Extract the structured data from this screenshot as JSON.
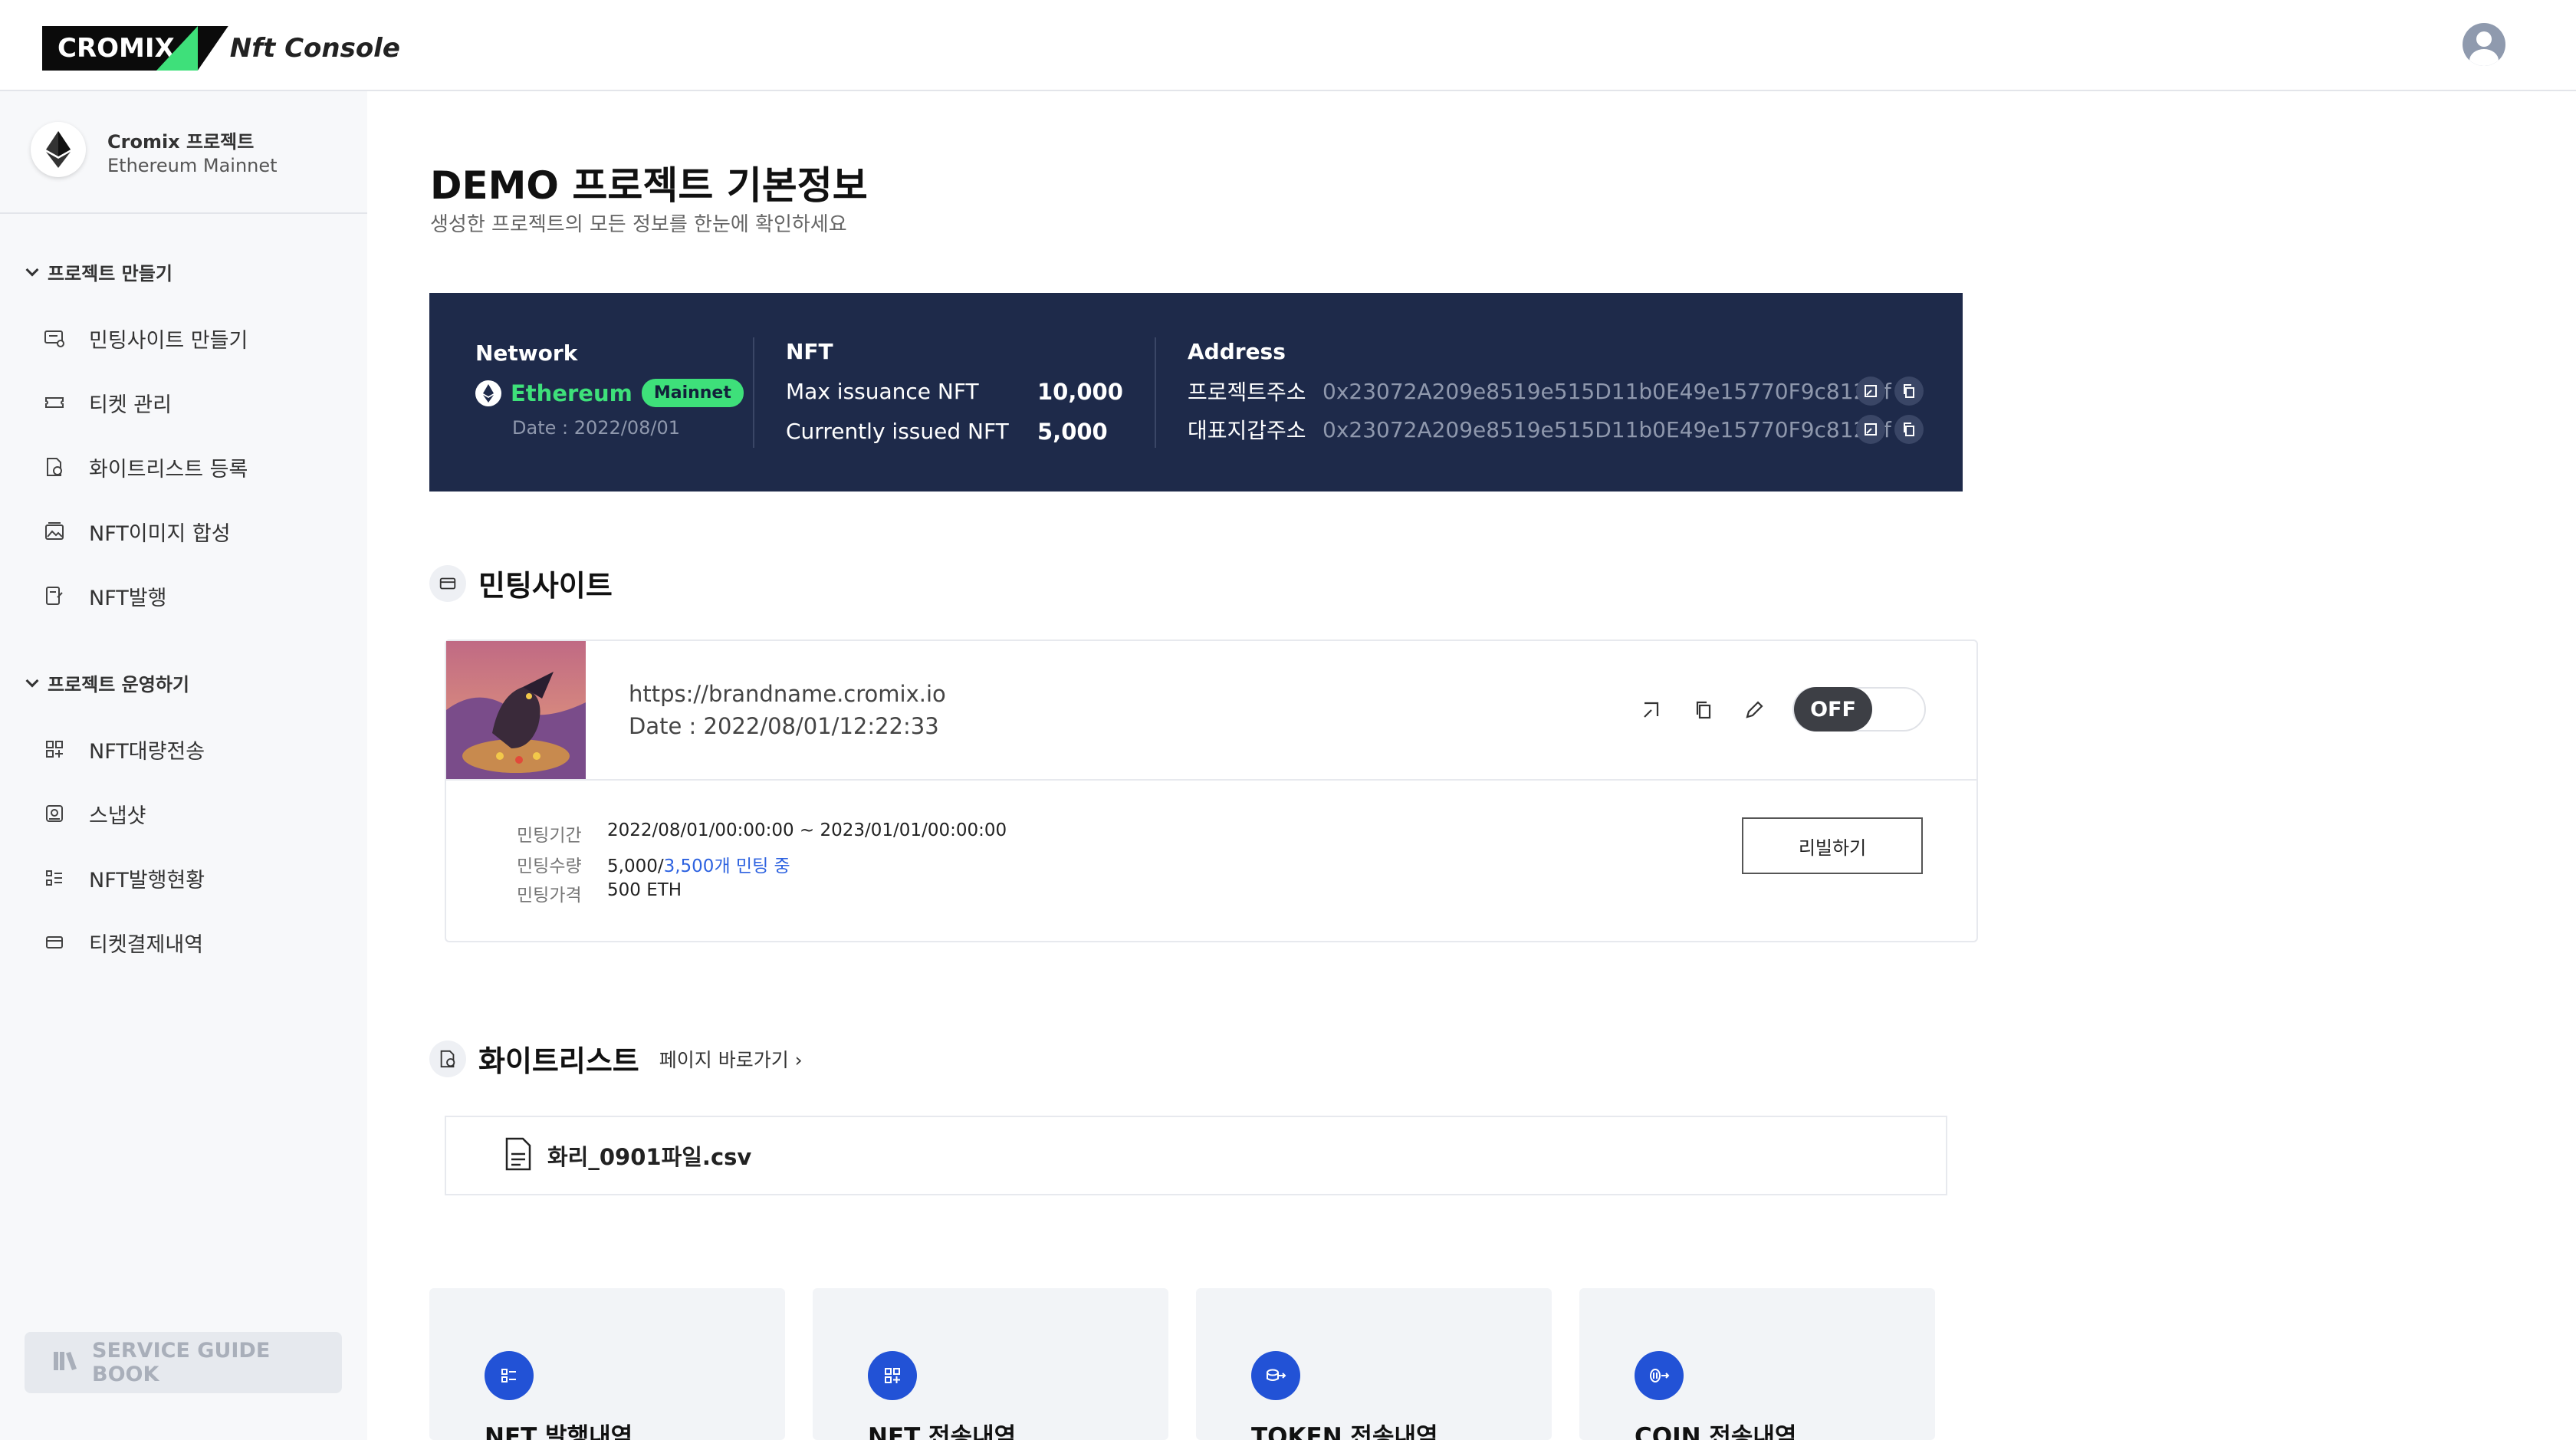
{
  "header": {
    "logo_text": "CROMIX",
    "logo_sub": "Nft Console",
    "user_icon": "user-circle-icon"
  },
  "sidebar": {
    "project_name": "Cromix 프로젝트",
    "project_network": "Ethereum Mainnet",
    "groups": [
      {
        "label": "프로젝트 만들기",
        "items": [
          {
            "label": "민팅사이트 만들기",
            "icon": "mint-site-icon"
          },
          {
            "label": "티켓 관리",
            "icon": "ticket-icon"
          },
          {
            "label": "화이트리스트 등록",
            "icon": "whitelist-icon"
          },
          {
            "label": "NFT이미지 합성",
            "icon": "image-compose-icon"
          },
          {
            "label": "NFT발행",
            "icon": "nft-issue-icon"
          }
        ]
      },
      {
        "label": "프로젝트 운영하기",
        "items": [
          {
            "label": "NFT대량전송",
            "icon": "bulk-transfer-icon"
          },
          {
            "label": "스냅샷",
            "icon": "snapshot-icon"
          },
          {
            "label": "NFT발행현황",
            "icon": "issue-status-icon"
          },
          {
            "label": "티켓결제내역",
            "icon": "payment-icon"
          }
        ]
      }
    ],
    "guide_label": "SERVICE GUIDE BOOK"
  },
  "main": {
    "title": "DEMO 프로젝트 기본정보",
    "subtitle": "생성한 프로젝트의 모든 정보를 한눈에 확인하세요",
    "info": {
      "network_label": "Network",
      "network_name": "Ethereum",
      "network_badge": "Mainnet",
      "date": "Date : 2022/08/01",
      "nft_label": "NFT",
      "max_label": "Max issuance NFT",
      "max_value": "10,000",
      "issued_label": "Currently issued NFT",
      "issued_value": "5,000",
      "address_label": "Address",
      "project_addr_label": "프로젝트주소",
      "project_addr": "0x23072A209e8519e515D11b0E49e15770F9c812Df",
      "wallet_addr_label": "대표지갑주소",
      "wallet_addr": "0x23072A209e8519e515D11b0E49e15770F9c812Df"
    },
    "minting": {
      "section_title": "민팅사이트",
      "url": "https://brandname.cromix.io",
      "date": "Date : 2022/08/01/12:22:33",
      "toggle": "OFF",
      "period_label": "민팅기간",
      "period_value": "2022/08/01/00:00:00 ~ 2023/01/01/00:00:00",
      "count_label": "민팅수량",
      "count_total": "5,000/",
      "count_progress": "3,500개 민팅 중",
      "price_label": "민팅가격",
      "price_value": "500 ETH",
      "rebuild_label": "리빌하기"
    },
    "whitelist": {
      "section_title": "화이트리스트",
      "link": "페이지 바로가기",
      "file_name": "화리_0901파일.csv"
    },
    "tiles": [
      {
        "label": "NFT 발행내역",
        "icon": "list-icon"
      },
      {
        "label": "NFT 전송내역",
        "icon": "grid-plus-icon"
      },
      {
        "label": "TOKEN 전송내역",
        "icon": "token-transfer-icon"
      },
      {
        "label": "COIN 전송내역",
        "icon": "coin-transfer-icon"
      }
    ],
    "colors": {
      "navy": "#1e2a4a",
      "green": "#3ee07a",
      "blue": "#2252d6"
    }
  }
}
